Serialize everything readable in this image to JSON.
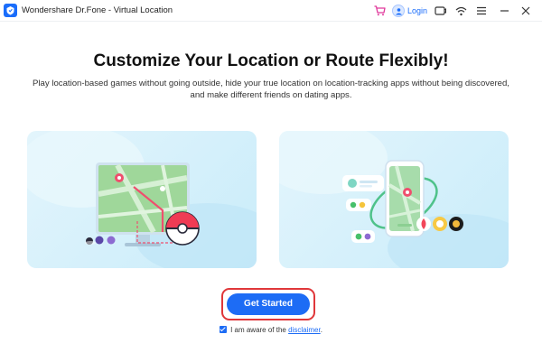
{
  "window": {
    "title": "Wondershare Dr.Fone - Virtual Location",
    "login_label": "Login",
    "controls": [
      "cart-icon",
      "user-icon",
      "feedback-icon",
      "wifi-icon",
      "menu-icon",
      "minimize-icon",
      "close-icon"
    ]
  },
  "main": {
    "headline": "Customize Your Location or Route Flexibly!",
    "description": "Play location-based games without going outside,  hide your true location on location-tracking apps without being discovered, and make different friends on dating apps.",
    "cta_label": "Get Started",
    "consent_text": "I am aware of the",
    "consent_link": "disclaimer",
    "consent_suffix": "."
  },
  "illustrations": {
    "left": "games-illustration",
    "right": "dating-apps-illustration"
  },
  "colors": {
    "accent": "#1d6cf5",
    "highlight_border": "#e0373a",
    "card_bg": "#d3effb",
    "cart": "#e0379b"
  }
}
